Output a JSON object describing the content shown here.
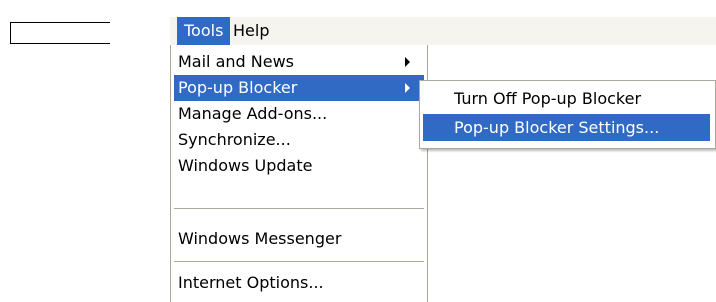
{
  "menubar": {
    "items": [
      {
        "label": "Tools"
      },
      {
        "label": "Help"
      }
    ]
  },
  "tools_menu": {
    "items": [
      {
        "label": "Mail and News",
        "has_submenu": true
      },
      {
        "label": "Pop-up Blocker",
        "has_submenu": true,
        "highlighted": true
      },
      {
        "label": "Manage Add-ons..."
      },
      {
        "label": "Synchronize..."
      },
      {
        "label": "Windows Update"
      },
      {
        "label": "Windows Messenger"
      },
      {
        "label": "Internet Options..."
      }
    ]
  },
  "popup_submenu": {
    "items": [
      {
        "label": "Turn Off Pop-up Blocker"
      },
      {
        "label": "Pop-up Blocker Settings...",
        "highlighted": true
      }
    ]
  },
  "colors": {
    "highlight": "#316ac5",
    "menubar_bg": "#f5f4ef",
    "border": "#aca899"
  }
}
